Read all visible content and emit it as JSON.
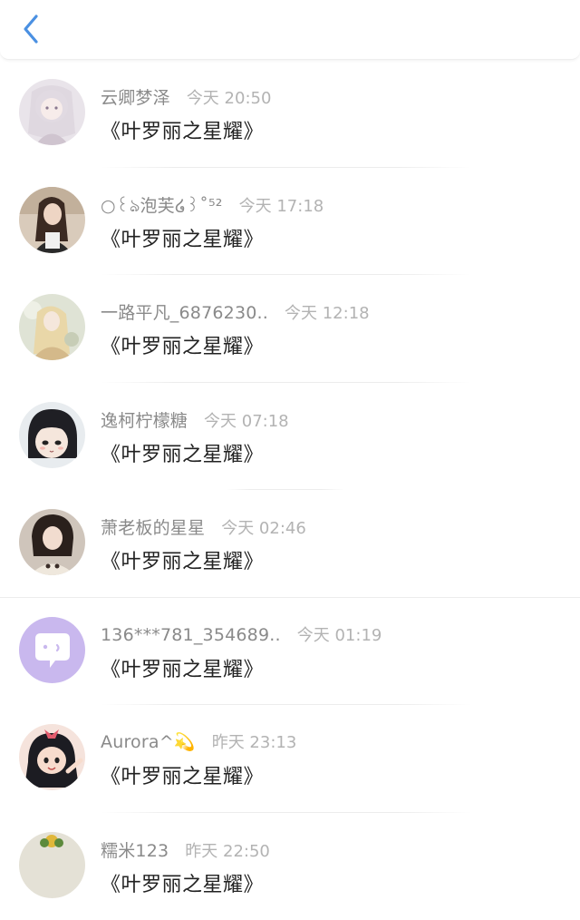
{
  "header": {
    "back_icon": "chevron-left-icon",
    "accent_color": "#4a90e2"
  },
  "items": [
    {
      "name": "云卿梦泽",
      "time": "今天 20:50",
      "message": "《叶罗丽之星耀》"
    },
    {
      "name": "○꒰ঌ泡芙໒꒱˚⁵²",
      "time": "今天 17:18",
      "message": "《叶罗丽之星耀》"
    },
    {
      "name": "一路平凡_6876230..",
      "time": "今天 12:18",
      "message": "《叶罗丽之星耀》"
    },
    {
      "name": "逸柯柠檬糖",
      "time": "今天 07:18",
      "message": "《叶罗丽之星耀》"
    },
    {
      "name": "萧老板的星星",
      "time": "今天 02:46",
      "message": "《叶罗丽之星耀》"
    },
    {
      "name": "136***781_354689..",
      "time": "今天 01:19",
      "message": "《叶罗丽之星耀》"
    },
    {
      "name": "Aurora^💫",
      "time": "昨天 23:13",
      "message": "《叶罗丽之星耀》"
    },
    {
      "name": "糯米123",
      "time": "昨天 22:50",
      "message": "《叶罗丽之星耀》"
    }
  ]
}
